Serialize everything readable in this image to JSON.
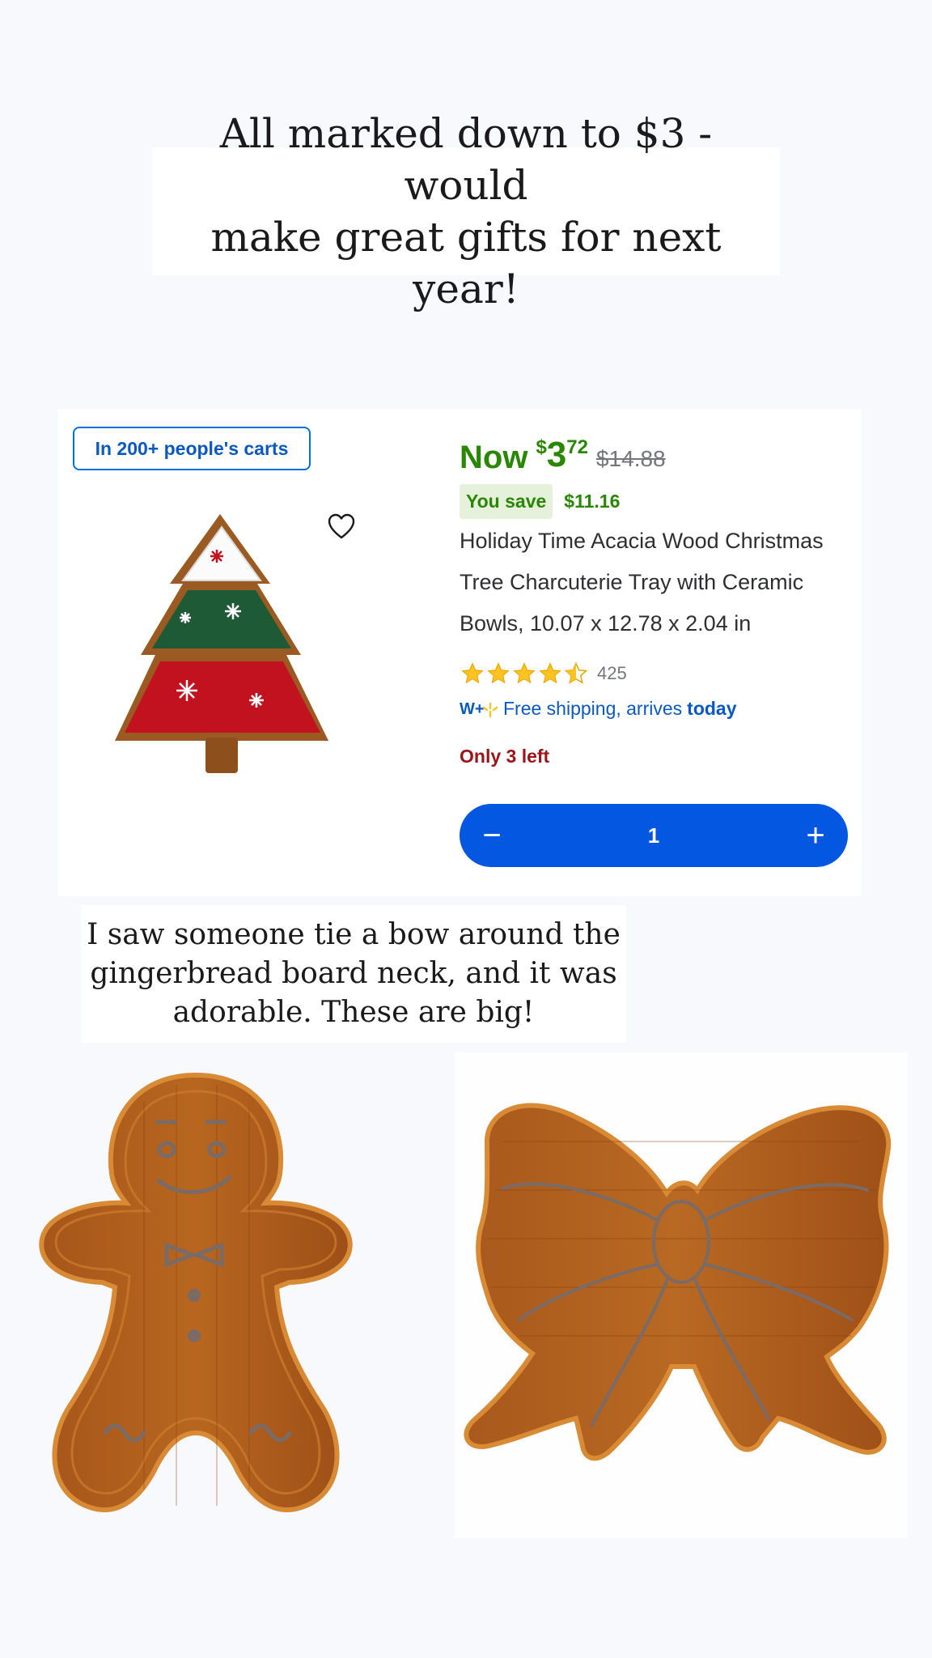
{
  "caption_top": {
    "line1": "All marked down to $3 - would",
    "line2": "make great gifts for next year!"
  },
  "product": {
    "badge": "In 200+ people's carts",
    "price": {
      "now_label": "Now",
      "currency": "$",
      "dollars": "3",
      "cents": "72",
      "was": "$14.88"
    },
    "savings": {
      "label": "You save",
      "amount": "$11.16"
    },
    "title": "Holiday Time Acacia Wood Christmas Tree Charcuterie Tray with Ceramic Bowls, 10.07 x 12.78 x 2.04 in",
    "rating": {
      "stars": 4.5,
      "out_of": 5,
      "count": "425"
    },
    "shipping": {
      "prefix": "Free shipping, arrives",
      "emphasis": "today",
      "icon": "walmart-plus-icon"
    },
    "stock": "Only 3 left",
    "quantity": {
      "value": "1",
      "minus": "−",
      "plus": "+"
    },
    "colors": {
      "accent": "#0457e0",
      "price_green": "#2a8703",
      "stock_red": "#9b1419",
      "link_blue": "#0a58c2"
    }
  },
  "caption_mid": {
    "line1": "I saw someone tie a bow around the",
    "line2": "gingerbread board neck, and it was",
    "line3": "adorable. These are big!"
  }
}
